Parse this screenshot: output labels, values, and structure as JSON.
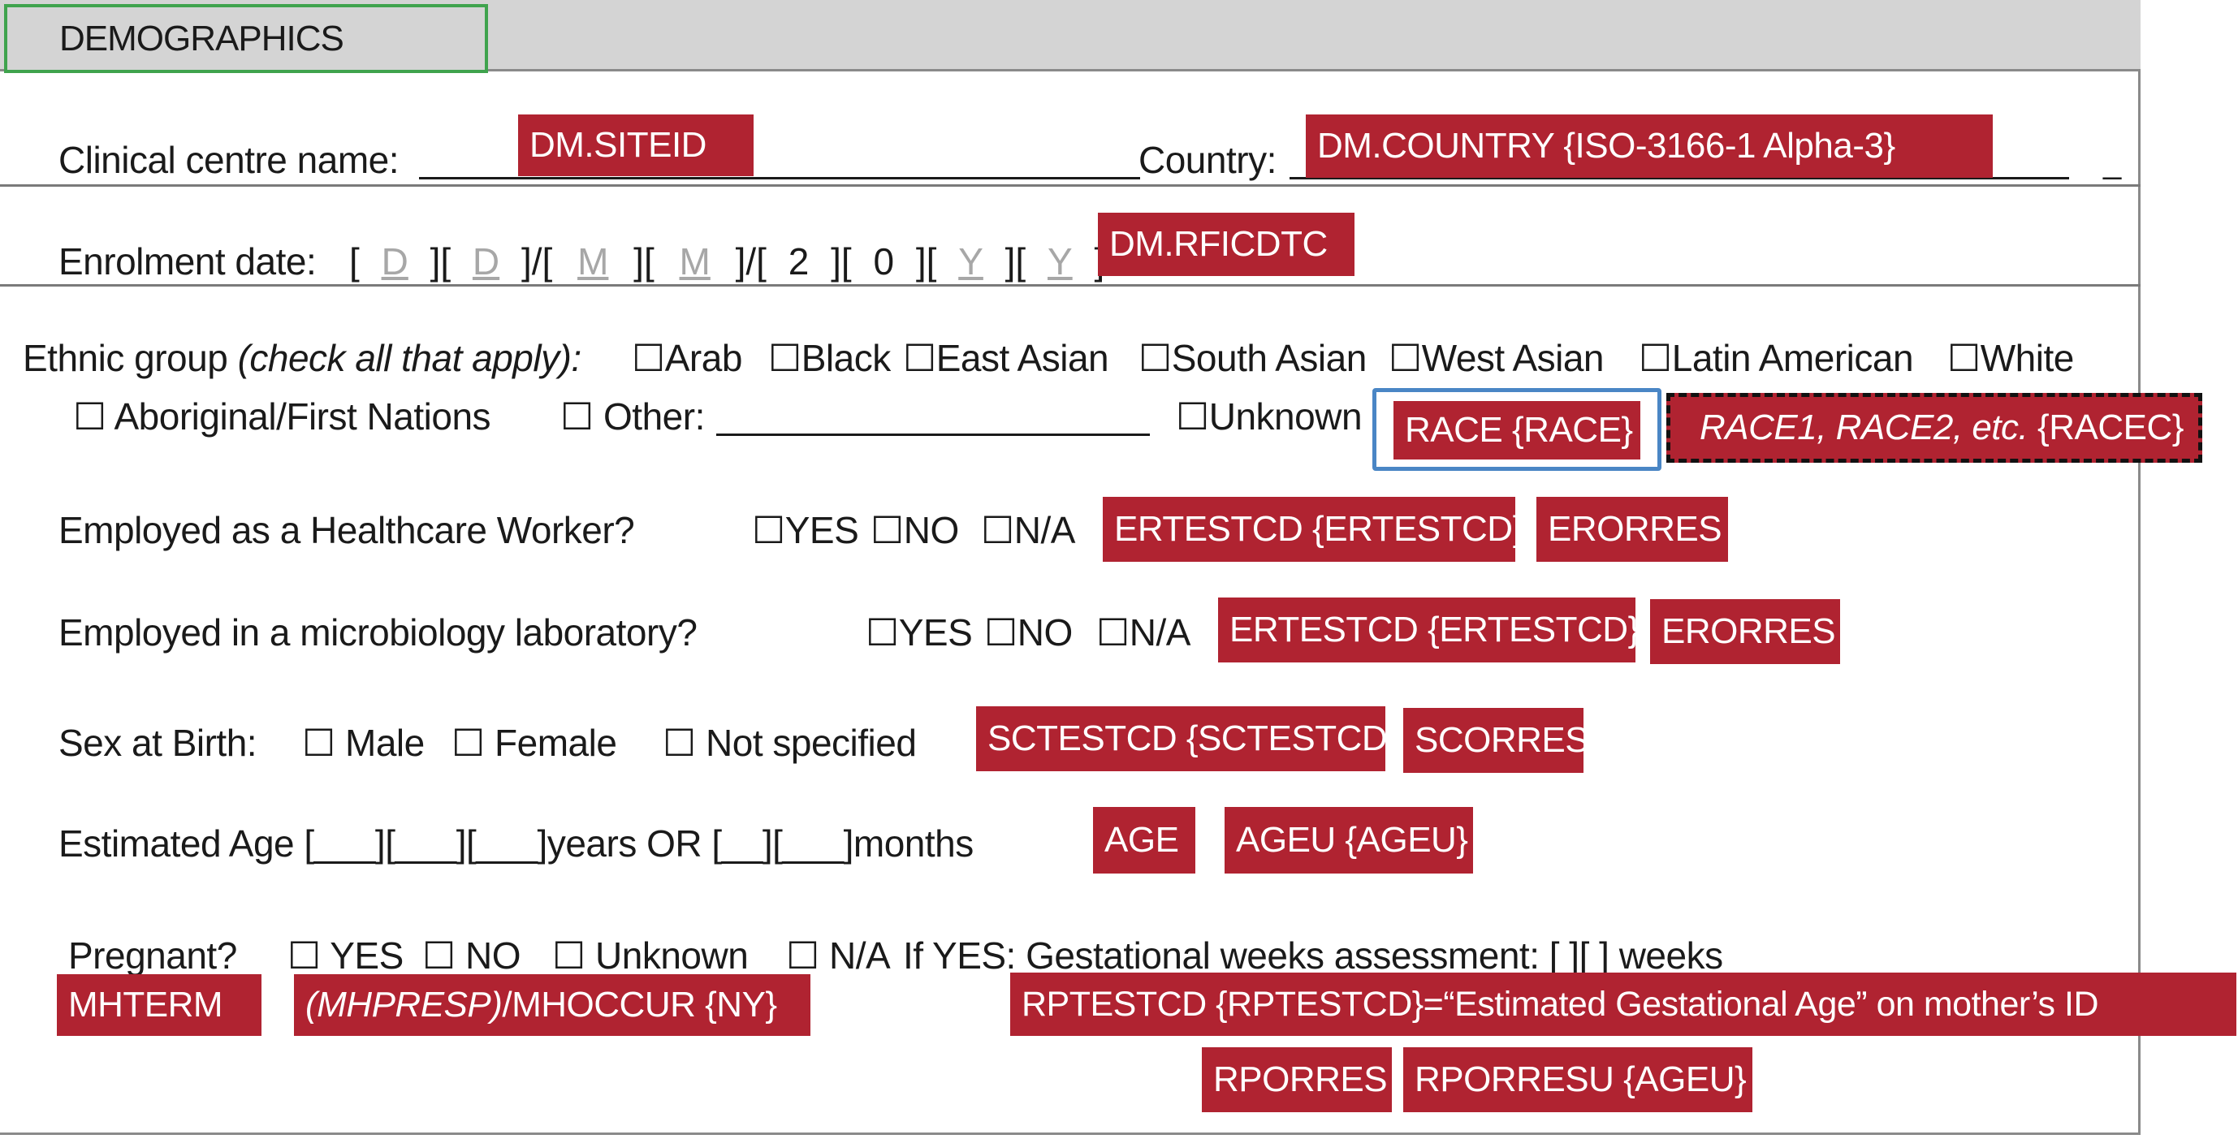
{
  "header": {
    "title": "DEMOGRAPHICS"
  },
  "row_site": {
    "clinical_label": "Clinical centre name:",
    "siteid_tag": "DM.SITEID",
    "country_label": "Country:",
    "country_tag": "DM.COUNTRY {ISO-3166-1 Alpha-3}",
    "trailing_dash": "_"
  },
  "row_enrol": {
    "label": "Enrolment date:",
    "open": "[",
    "d1": "D",
    "d2": "D",
    "m1": "M",
    "m2": "M",
    "y_fixed1": "2",
    "y_fixed2": "0",
    "y1": "Y",
    "y2": "Y",
    "sep1": "][",
    "slash": "]/[",
    "close": "]",
    "tag": "DM.RFICDTC"
  },
  "row_ethnic": {
    "label": "Ethnic group ",
    "label_italic": "(check all that apply):",
    "options_line1": [
      "Arab",
      "Black",
      "East Asian",
      "South Asian",
      "West Asian",
      "Latin American",
      "White"
    ],
    "option_aboriginal": "Aboriginal/First Nations",
    "option_other": "Other:",
    "option_unknown": "Unknown",
    "race_tag": "RACE {RACE}",
    "racec_tag_italic": "RACE1, RACE2, etc.",
    "racec_tag_rest": "{RACEC}"
  },
  "row_healthcare": {
    "label": "Employed as a Healthcare  Worker?",
    "options": [
      "YES",
      "NO",
      "N/A"
    ],
    "testcd_tag": "ERTESTCD {ERTESTCD}",
    "orres_tag": "ERORRES"
  },
  "row_microlab": {
    "label": "Employed in a microbiology laboratory?",
    "options": [
      "YES",
      "NO",
      "N/A"
    ],
    "testcd_tag": "ERTESTCD {ERTESTCD}",
    "orres_tag": "ERORRES"
  },
  "row_sex": {
    "label": "Sex at Birth:",
    "options": [
      "Male",
      "Female",
      "Not specified"
    ],
    "testcd_tag": "SCTESTCD {SCTESTCD}",
    "orres_tag": "SCORRES"
  },
  "row_age": {
    "text": "Estimated Age [___][___][___]years OR [__][___]months",
    "age_tag": "AGE",
    "ageu_tag": "AGEU {AGEU}"
  },
  "row_pregnant": {
    "label": "Pregnant?",
    "options": [
      "YES",
      "NO",
      "Unknown",
      "N/A"
    ],
    "if_yes_text": "If YES: Gestational  weeks assessment:  [     ][     ] weeks",
    "mhterm_tag": "MHTERM",
    "mhpresp_italic": "(MHPRESP)",
    "mhpresp_rest": "/MHOCCUR {NY}",
    "rptestcd_tag": "RPTESTCD {RPTESTCD}=“Estimated Gestational Age” on mother’s ID",
    "rporres_tag": "RPORRES",
    "rporresu_tag": "RPORRESU {AGEU}"
  },
  "icons": {
    "checkbox": "☐"
  },
  "colors": {
    "tag_fill": "#b02331",
    "header_fill": "#d4d4d4",
    "title_border": "#3fa34d",
    "race_highlight": "#4a86c5"
  }
}
